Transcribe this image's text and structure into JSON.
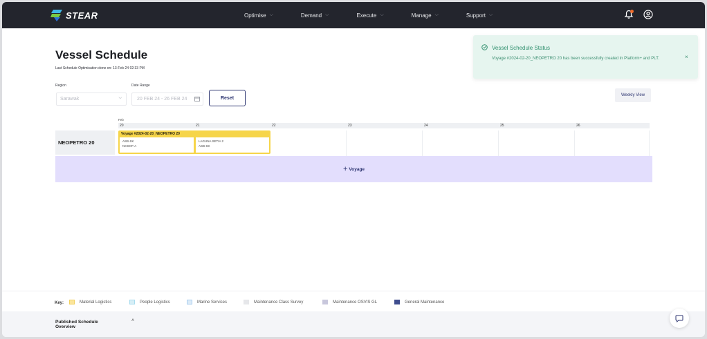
{
  "app": {
    "name": "STEAR"
  },
  "nav": {
    "items": [
      {
        "label": "Optimise"
      },
      {
        "label": "Demand"
      },
      {
        "label": "Execute"
      },
      {
        "label": "Manage"
      },
      {
        "label": "Support"
      }
    ]
  },
  "colors": {
    "topbar": "#23252d",
    "accent": "#2c3470",
    "voyage": "#f6d54a",
    "add_voyage": "#e3defd",
    "toast_bg": "#e6f5ef",
    "notif_dot": "#f06c2c"
  },
  "page": {
    "title": "Vessel Schedule",
    "last_optimisation": "Last Schedule Optimisation done on: 13-Feb-24 02:33 PM"
  },
  "filters": {
    "region_label": "Region",
    "region_value": "Sarawak",
    "date_range_label": "Date Range",
    "date_range_value": "20 FEB 24 - 26 FEB 24",
    "reset_label": "Reset",
    "weekly_view_label": "Weekly View"
  },
  "toast": {
    "title": "Vessel Schedule Status",
    "message": "Voyage #2024-02-20_NEOPETRO 20 has been successfully created in Platform+ and PLT.",
    "close": "×"
  },
  "schedule": {
    "month": "Feb",
    "days": [
      "20",
      "21",
      "22",
      "23",
      "24",
      "25",
      "26"
    ],
    "vessel": "NEOPETRO 20",
    "voyage": {
      "title": "Voyage #2024-02-20_NEOPETRO 20",
      "day1_line1": "ASB-SK",
      "day1_line2": "NCSCP-A",
      "day2_line1": "LAGUNA SETIA 2",
      "day2_line2": "ASB-SK"
    },
    "add_voyage_label": "Voyage"
  },
  "legend": {
    "key_label": "Key:",
    "items": [
      {
        "label": "Material Logistics",
        "color": "#fbe59a"
      },
      {
        "label": "People Logistics",
        "color": "#d6eef6"
      },
      {
        "label": "Marine Services",
        "color": "#dcebf7"
      },
      {
        "label": "Maintenance Class Survey",
        "color": "#e6e7ea"
      },
      {
        "label": "Maintenance OSVIS GL",
        "color": "#c8c7dc"
      },
      {
        "label": "General Maintenance",
        "color": "#3f4d8e"
      }
    ]
  },
  "bottom": {
    "published_title": "Published Schedule Overview"
  }
}
